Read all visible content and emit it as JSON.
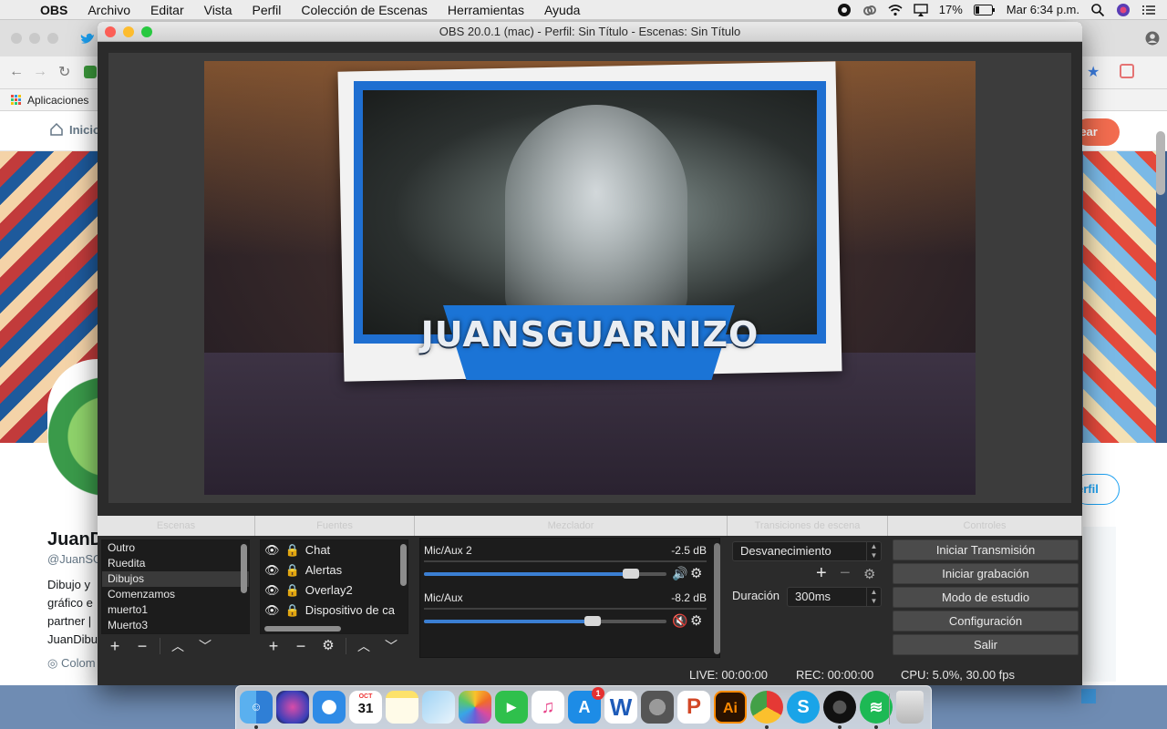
{
  "menubar": {
    "app_name": "OBS",
    "items": [
      "Archivo",
      "Editar",
      "Vista",
      "Perfil",
      "Colección de Escenas",
      "Herramientas",
      "Ayuda"
    ],
    "battery": "17%",
    "clock": "Mar 6:34 p.m."
  },
  "browser": {
    "bookmarks_label": "Aplicaciones",
    "nav_home": "Inicio",
    "cta_partial": "tear",
    "profile_name_partial": "JuanD",
    "profile_handle_partial": "@JuanSG",
    "bio_lines": [
      "Dibujo y",
      "gráfico e",
      "partner |",
      "JuanDibu"
    ],
    "location_partial": "Colom",
    "follow_partial": "erfil"
  },
  "obs": {
    "title": "OBS 20.0.1 (mac) - Perfil: Sin Título - Escenas: Sin Título",
    "preview_overlay_text": "JUANSGUARNIZO",
    "dock_headers": [
      "Escenas",
      "Fuentes",
      "Mezclador",
      "Transiciones de escena",
      "Controles"
    ],
    "scenes": [
      {
        "label": "Outro"
      },
      {
        "label": "Ruedita"
      },
      {
        "label": "Dibujos",
        "selected": true
      },
      {
        "label": "Comenzamos"
      },
      {
        "label": "muerto1"
      },
      {
        "label": "Muerto3"
      }
    ],
    "sources": [
      {
        "label": "Chat"
      },
      {
        "label": "Alertas"
      },
      {
        "label": "Overlay2"
      },
      {
        "label": "Dispositivo de ca"
      }
    ],
    "mixer": [
      {
        "name": "Mic/Aux 2",
        "db": "-2.5 dB",
        "level": 0.88,
        "muted": false
      },
      {
        "name": "Mic/Aux",
        "db": "-8.2 dB",
        "level": 0.71,
        "muted": true
      }
    ],
    "transition": {
      "selected": "Desvanecimiento",
      "duration_label": "Duración",
      "duration_value": "300ms"
    },
    "controls": [
      "Iniciar Transmisión",
      "Iniciar grabación",
      "Modo de estudio",
      "Configuración",
      "Salir"
    ],
    "status": {
      "live": "LIVE: 00:00:00",
      "rec": "REC: 00:00:00",
      "cpu": "CPU: 5.0%, 30.00 fps"
    }
  },
  "dock": {
    "calendar_month": "OCT",
    "calendar_day": "31",
    "appstore_badge": "1",
    "apps": [
      "finder",
      "siri",
      "safari",
      "calendar",
      "notes",
      "preview",
      "photos",
      "facetime",
      "itunes",
      "app-store",
      "word",
      "system-preferences",
      "powerpoint",
      "illustrator",
      "chrome",
      "skype",
      "obs",
      "spotify",
      "trash"
    ]
  },
  "colors": {
    "obs_bg": "#2b2b2b",
    "accent_blue": "#3b7fd3",
    "button_bg": "#4b4b4b"
  }
}
